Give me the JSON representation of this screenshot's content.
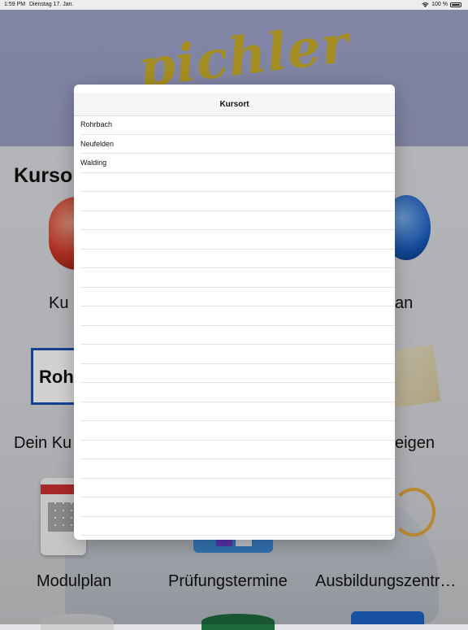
{
  "status_bar": {
    "time": "1:59 PM",
    "date": "Dienstag 17. Jan.",
    "battery": "100 %",
    "icons": [
      "wifi-icon",
      "battery-icon"
    ]
  },
  "header": {
    "brand": "pichler",
    "brand_color": "#c9ad2a",
    "background_color": "#9fa3c9"
  },
  "page": {
    "section_title": "Kurso",
    "tiles": [
      {
        "label": "Ku",
        "icon": "location-pin-icon"
      },
      {
        "label": "an",
        "icon": "globe-icon"
      },
      {
        "label": "Dein Ku",
        "icon": "town-sign-icon",
        "sign_text": "Roh"
      },
      {
        "label": "eigen",
        "icon": "map-icon"
      },
      {
        "label": "Modulplan",
        "icon": "calendar-icon"
      },
      {
        "label": "Prüfungstermine",
        "icon": "exam-calendar-icon"
      },
      {
        "label": "Ausbildungszentr…",
        "icon": "training-center-icon"
      }
    ]
  },
  "popover": {
    "title": "Kursort",
    "options": [
      "Rohrbach",
      "Neufelden",
      "Walding"
    ],
    "empty_rows": 19
  }
}
